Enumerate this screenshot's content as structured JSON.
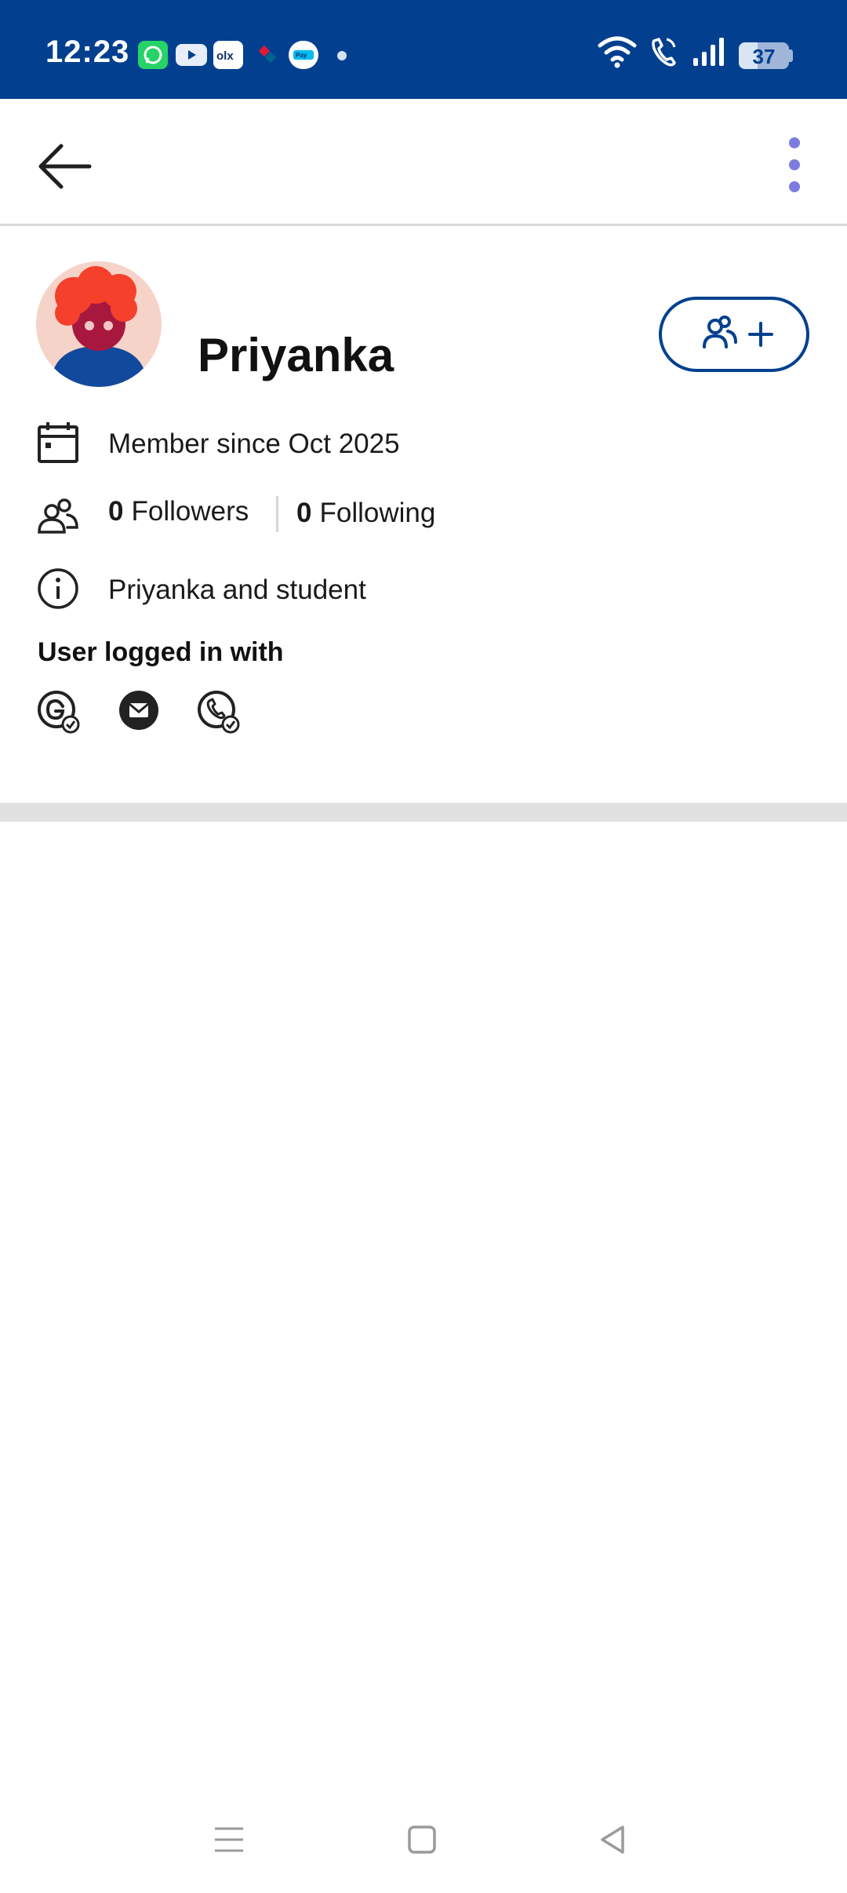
{
  "status_bar": {
    "time": "12:23",
    "battery": "37",
    "battery_level_percent": 37,
    "app_icons": [
      "whatsapp-icon",
      "youtube-icon",
      "olx-icon",
      "dominos-icon",
      "paytm-icon"
    ]
  },
  "colors": {
    "primary": "#02408f",
    "accent": "#7c7ce0",
    "avatar_bg": "#f6d3c8",
    "avatar_hair": "#f5402c",
    "avatar_face": "#a8183e",
    "avatar_body": "#11499c"
  },
  "profile": {
    "name": "Priyanka",
    "member_since": "Member since Oct 2025",
    "followers_count": "0",
    "followers_label": "Followers",
    "following_count": "0",
    "following_label": "Following",
    "bio": "Priyanka and student"
  },
  "login": {
    "title": "User logged in with",
    "methods": [
      "google-verified-icon",
      "email-icon",
      "phone-verified-icon"
    ]
  },
  "nav": {
    "icons": [
      "menu-icon",
      "home-icon",
      "back-nav-icon"
    ]
  }
}
